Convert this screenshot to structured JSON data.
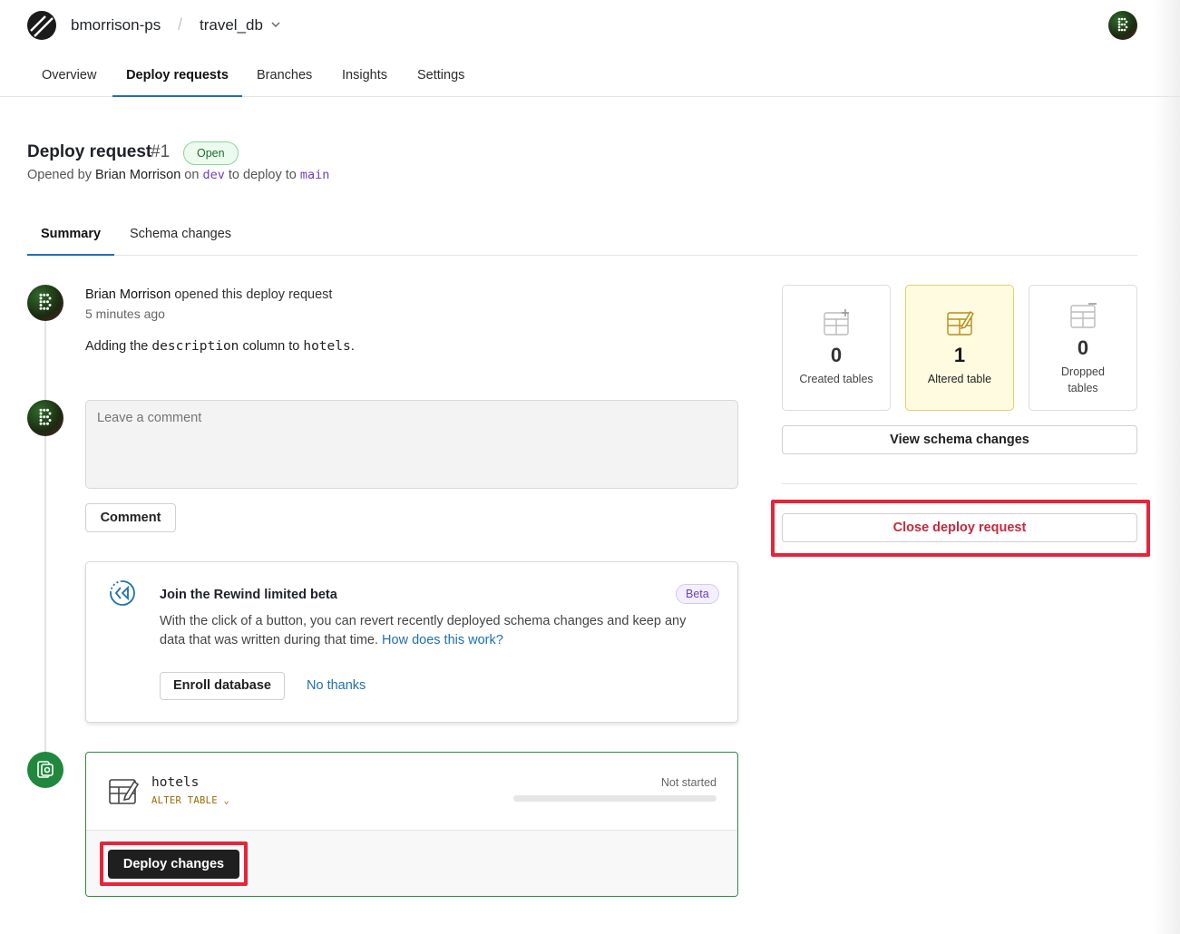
{
  "header": {
    "org": "bmorrison-ps",
    "separator": "/",
    "database": "travel_db"
  },
  "nav": {
    "tabs": [
      "Overview",
      "Deploy requests",
      "Branches",
      "Insights",
      "Settings"
    ],
    "active": "Deploy requests"
  },
  "request": {
    "title": "Deploy request",
    "number": "#1",
    "status": "Open",
    "opened_by_prefix": "Opened by",
    "author": "Brian Morrison",
    "on_text": "on",
    "from_branch": "dev",
    "to_text": "to deploy to",
    "to_branch": "main"
  },
  "subtabs": {
    "items": [
      "Summary",
      "Schema changes"
    ],
    "active": "Summary"
  },
  "event": {
    "author": "Brian Morrison",
    "action": "opened this deploy request",
    "time": "5 minutes ago",
    "desc_prefix": "Adding the",
    "desc_column": "description",
    "desc_mid": "column to",
    "desc_table": "hotels",
    "desc_suffix": "."
  },
  "comment": {
    "placeholder": "Leave a comment",
    "button": "Comment"
  },
  "rewind": {
    "title": "Join the Rewind limited beta",
    "badge": "Beta",
    "body": "With the click of a button, you can revert recently deployed schema changes and keep any data that was written during that time.",
    "link": "How does this work?",
    "enroll": "Enroll database",
    "no_thanks": "No thanks"
  },
  "deploy": {
    "table": "hotels",
    "operation": "ALTER TABLE",
    "status": "Not started",
    "progress": 0,
    "button": "Deploy changes"
  },
  "stats": {
    "created": {
      "count": "0",
      "label": "Created tables"
    },
    "altered": {
      "count": "1",
      "label": "Altered table"
    },
    "dropped": {
      "count": "0",
      "label_line1": "Dropped",
      "label_line2": "tables"
    }
  },
  "actions": {
    "view_schema": "View schema changes",
    "close": "Close deploy request"
  },
  "colors": {
    "accent_blue": "#1f6fb3",
    "open_green": "#1b6b35",
    "branch_purple": "#6b3fbf",
    "danger_red": "#c8283c",
    "highlight_red": "#e8243a",
    "altered_yellow": "#fffbe0"
  }
}
